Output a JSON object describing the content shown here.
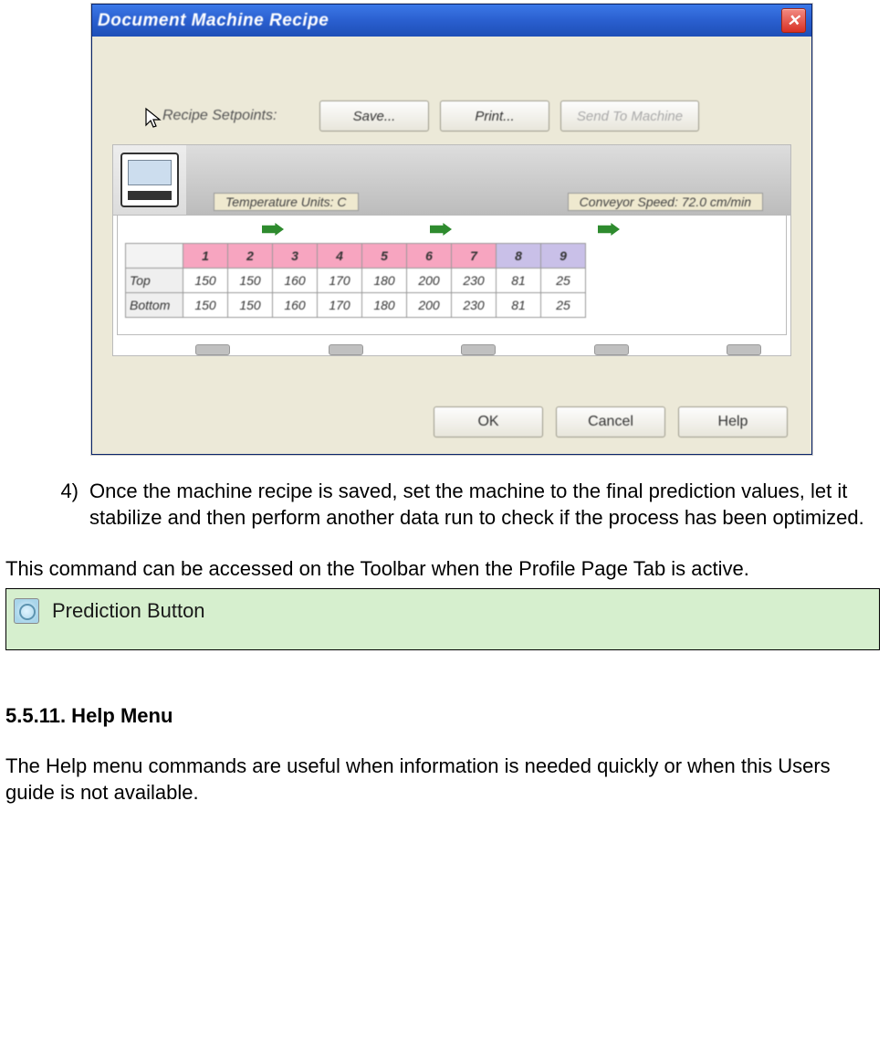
{
  "dialog": {
    "title": "Document Machine Recipe",
    "setpoints_label": "Recipe Setpoints:",
    "buttons": {
      "save": "Save...",
      "print": "Print...",
      "send": "Send To Machine"
    },
    "temp_units": "Temperature Units: C",
    "conveyor": "Conveyor Speed: 72.0  cm/min",
    "table": {
      "zones": [
        "1",
        "2",
        "3",
        "4",
        "5",
        "6",
        "7",
        "8",
        "9"
      ],
      "rows": [
        {
          "label": "Top",
          "vals": [
            "150",
            "150",
            "160",
            "170",
            "180",
            "200",
            "230",
            "81",
            "25"
          ]
        },
        {
          "label": "Bottom",
          "vals": [
            "150",
            "150",
            "160",
            "170",
            "180",
            "200",
            "230",
            "81",
            "25"
          ]
        }
      ]
    },
    "bottom": {
      "ok": "OK",
      "cancel": "Cancel",
      "help": "Help"
    }
  },
  "doc": {
    "step4_num": "4)",
    "step4": "Once the machine recipe is saved, set the machine to the final prediction values, let it stabilize and then perform another data run to check if the process has been optimized.",
    "toolbar_line": "This command can be accessed on the Toolbar when the Profile Page Tab is active.",
    "pred_label": "Prediction Button",
    "sec_head": "5.5.11. Help Menu",
    "help_para": "The Help menu commands are useful when information is needed quickly or when this Users guide is not available."
  }
}
